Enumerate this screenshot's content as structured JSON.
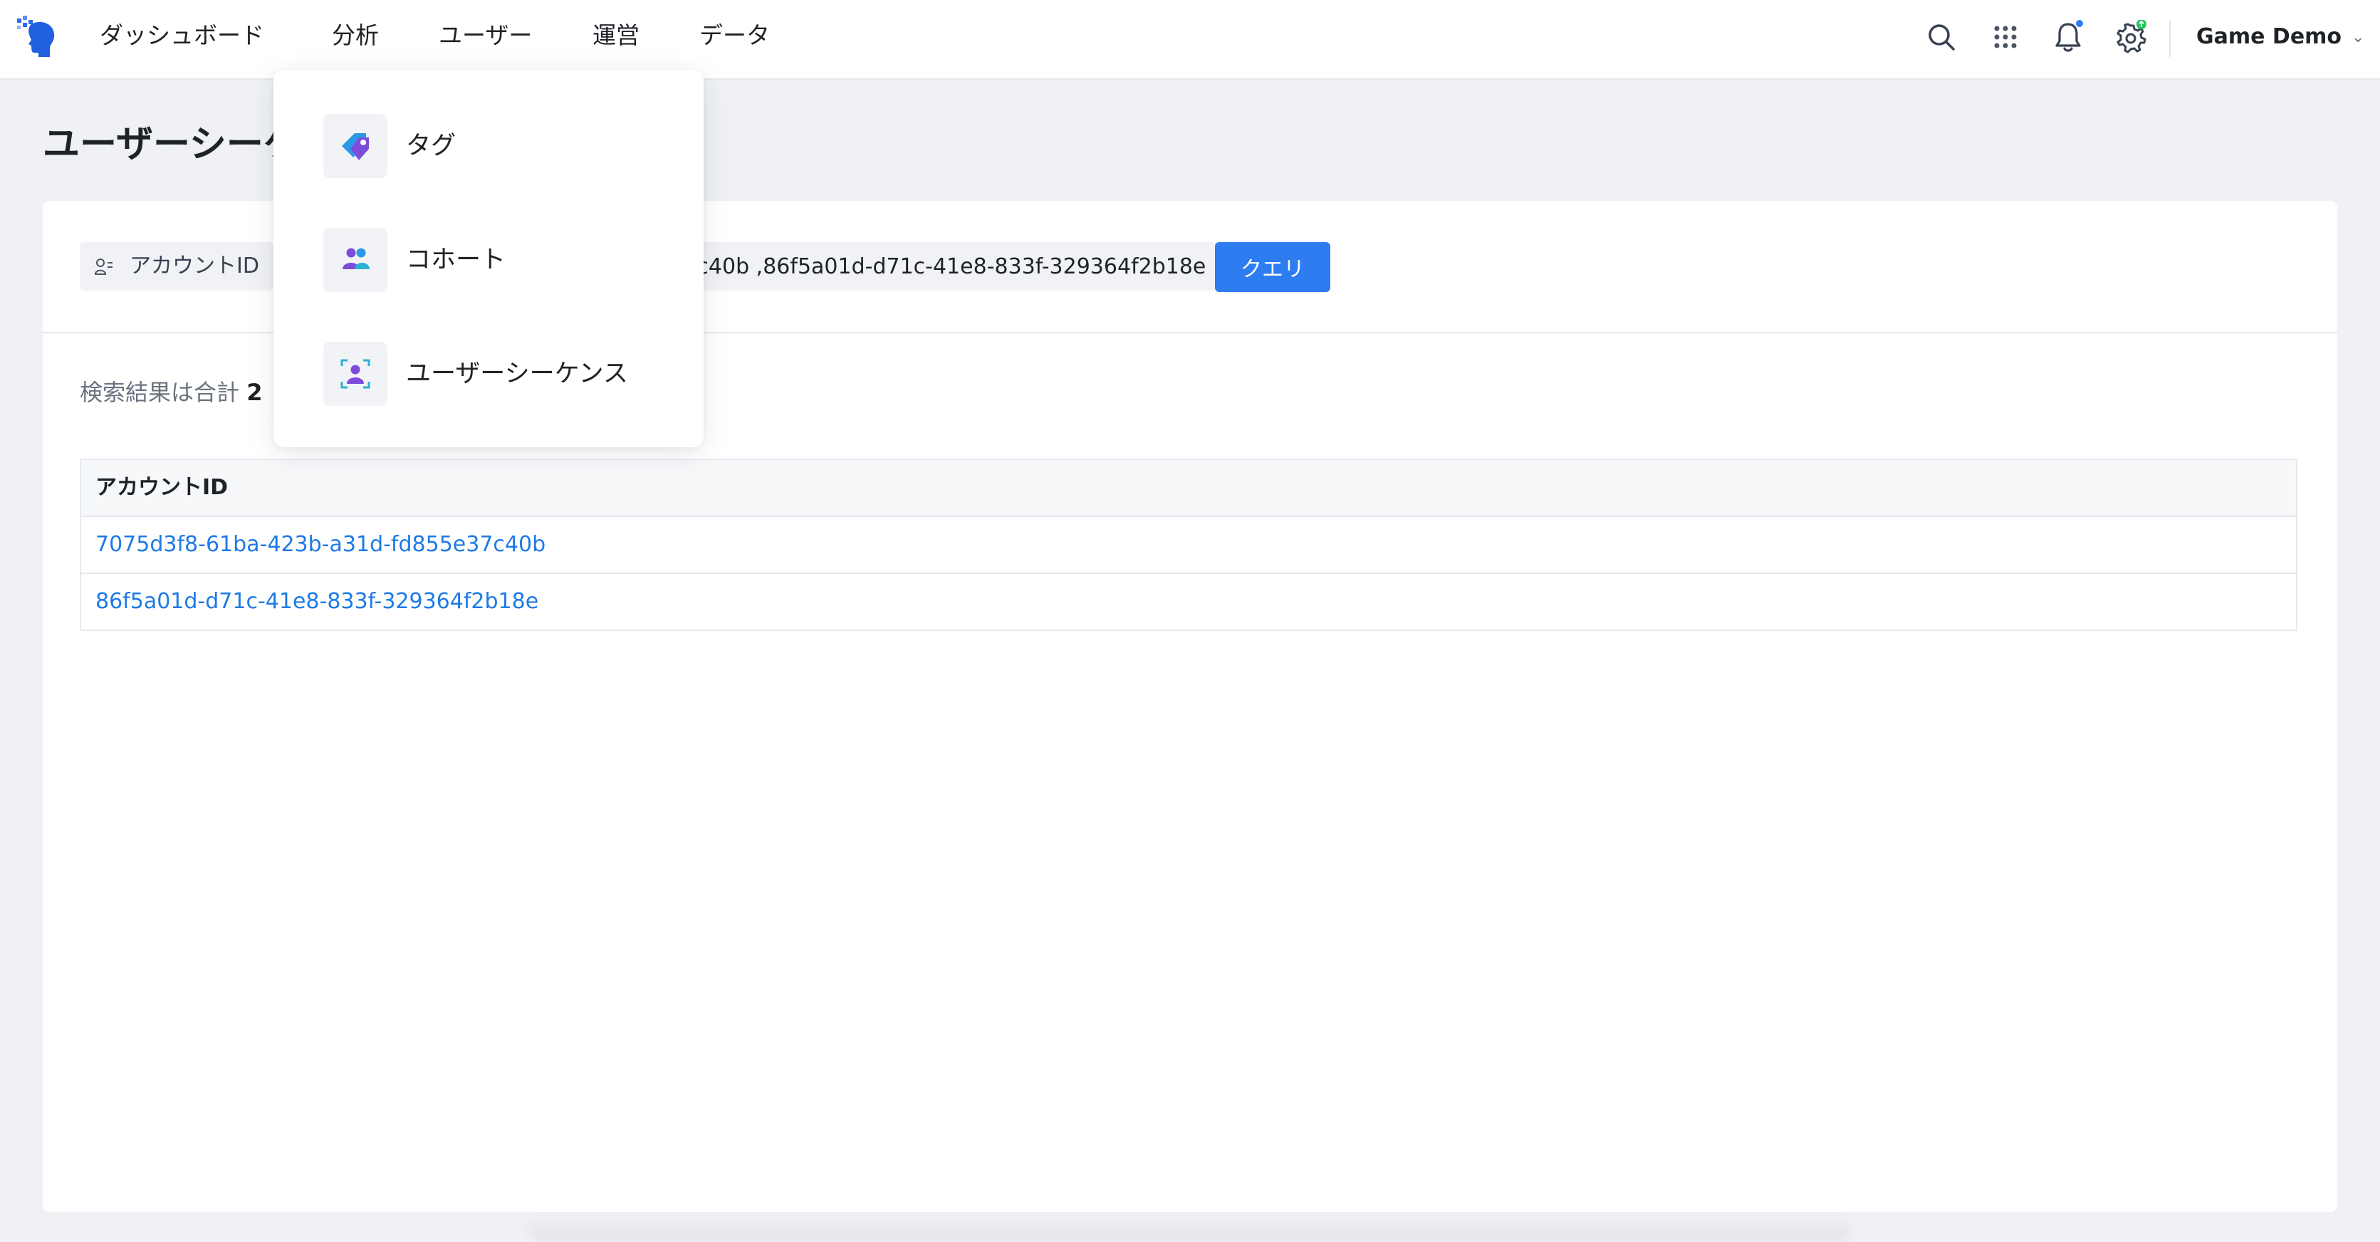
{
  "nav": {
    "items": [
      {
        "label": "ダッシュボード"
      },
      {
        "label": "分析"
      },
      {
        "label": "ユーザー"
      },
      {
        "label": "運営"
      },
      {
        "label": "データ"
      }
    ],
    "project_name": "Game Demo",
    "icons": [
      "search-icon",
      "apps-grid-icon",
      "notification-bell-icon",
      "settings-gear-icon"
    ],
    "notification_dot_color": "#2d7cf0",
    "settings_badge_color": "#22c55e"
  },
  "page": {
    "title": "ユーザーシーケンス"
  },
  "query": {
    "field_label": "アカウントID",
    "input_value": "7075d3f8-61ba-423b-a31d-fd855e37c40b ,86f5a01d-d71c-41e8-833f-329364f2b18e",
    "button_label": "クエリ",
    "button_color": "#2d7cf0"
  },
  "results": {
    "summary_prefix": "検索結果は合計",
    "summary_count": "2",
    "column_header": "アカウントID",
    "rows": [
      "7075d3f8-61ba-423b-a31d-fd855e37c40b",
      "86f5a01d-d71c-41e8-833f-329364f2b18e"
    ],
    "link_color": "#1e7ae6"
  },
  "dropdown": {
    "items": [
      {
        "label": "タグ",
        "icon": "tag-icon"
      },
      {
        "label": "コホート",
        "icon": "cohort-users-icon"
      },
      {
        "label": "ユーザーシーケンス",
        "icon": "user-sequence-icon"
      }
    ]
  }
}
